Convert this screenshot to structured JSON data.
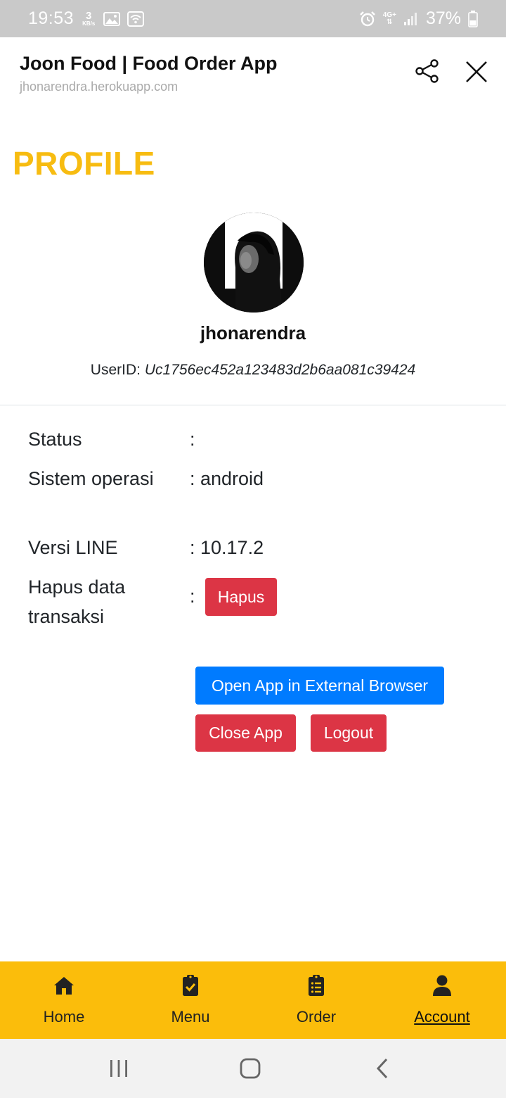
{
  "status_bar": {
    "time": "19:53",
    "speed_value": "3",
    "speed_unit": "KB/s",
    "network": "4G+",
    "battery": "37%"
  },
  "header": {
    "title": "Joon Food | Food Order App",
    "url": "jhonarendra.herokuapp.com"
  },
  "page": {
    "title": "PROFILE"
  },
  "profile": {
    "username": "jhonarendra",
    "userid_label": "UserID:",
    "userid_value": "Uc1756ec452a123483d2b6aa081c39424"
  },
  "info": [
    {
      "label": "Status",
      "value": ":"
    },
    {
      "label": "Sistem operasi",
      "value": ": android"
    },
    {
      "label": "Versi LINE",
      "value": ": 10.17.2"
    },
    {
      "label": "Hapus data transaksi",
      "value": ":"
    }
  ],
  "buttons": {
    "hapus": "Hapus",
    "open_external": "Open App in External Browser",
    "close_app": "Close App",
    "logout": "Logout"
  },
  "bottom_nav": [
    {
      "label": "Home",
      "icon": "home-icon"
    },
    {
      "label": "Menu",
      "icon": "clipboard-check-icon"
    },
    {
      "label": "Order",
      "icon": "clipboard-list-icon"
    },
    {
      "label": "Account",
      "icon": "user-icon",
      "active": true
    }
  ],
  "colors": {
    "accent": "#f7bc11",
    "nav_bg": "#fbbd0b",
    "danger": "#dc3545",
    "primary": "#007bff"
  }
}
